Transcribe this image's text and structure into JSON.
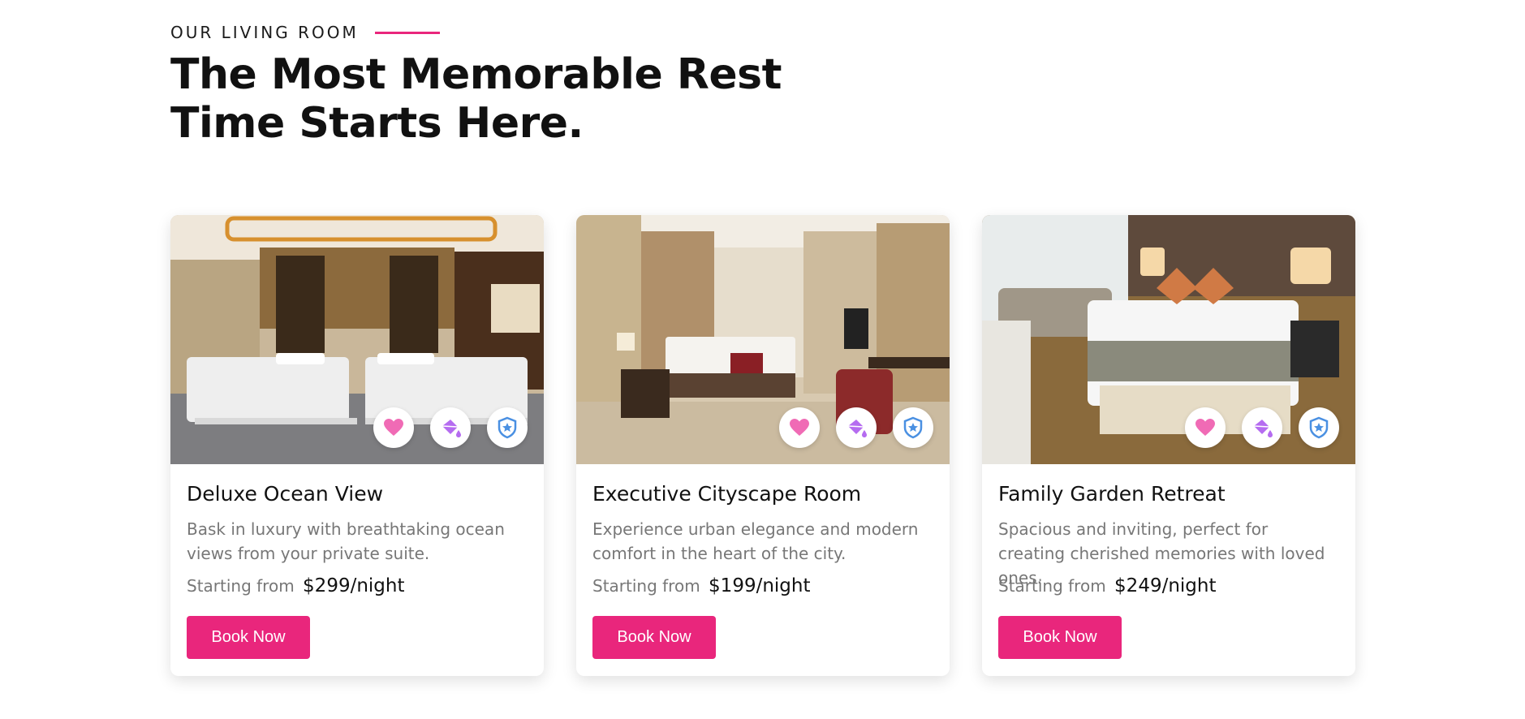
{
  "section": {
    "eyebrow": "OUR LIVING ROOM",
    "heading": "The Most Memorable Rest Time Starts Here."
  },
  "colors": {
    "accent": "#e9267c",
    "heart": "#f06bb5",
    "bucket": "#b56cf0",
    "shield": "#4a90e2"
  },
  "cards": [
    {
      "title": "Deluxe Ocean View",
      "description": "Bask in luxury with breathtaking ocean views from your private suite.",
      "price_prefix": "Starting from",
      "price": "$299/night",
      "button": "Book Now",
      "icons": [
        "heart-icon",
        "paint-bucket-icon",
        "shield-star-icon"
      ]
    },
    {
      "title": "Executive Cityscape Room",
      "description": "Experience urban elegance and modern comfort in the heart of the city.",
      "price_prefix": "Starting from",
      "price": "$199/night",
      "button": "Book Now",
      "icons": [
        "heart-icon",
        "paint-bucket-icon",
        "shield-star-icon"
      ]
    },
    {
      "title": "Family Garden Retreat",
      "description": "Spacious and inviting, perfect for creating cherished memories with loved ones.",
      "price_prefix": "Starting from",
      "price": "$249/night",
      "button": "Book Now",
      "icons": [
        "heart-icon",
        "paint-bucket-icon",
        "shield-star-icon"
      ]
    }
  ]
}
